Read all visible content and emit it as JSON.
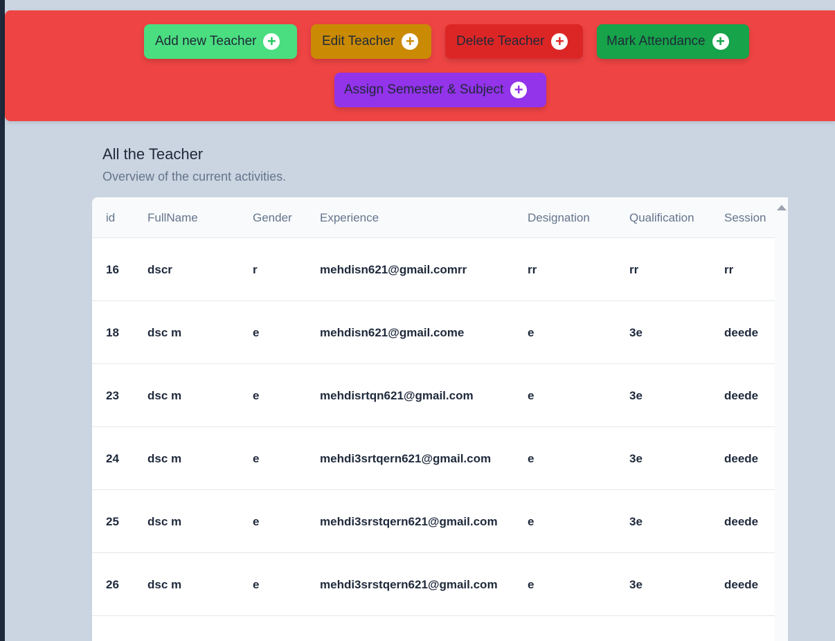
{
  "toolbar": {
    "buttons": [
      {
        "label": "Add new Teacher",
        "icon": "plus-circle-icon",
        "color": "#4ade80",
        "icon_color": "#22c55e"
      },
      {
        "label": "Edit Teacher",
        "icon": "plus-circle-icon",
        "color": "#ca8a04",
        "icon_color": "#ca8a04"
      },
      {
        "label": "Delete Teacher",
        "icon": "plus-circle-icon",
        "color": "#dc2626",
        "icon_color": "#dc2626"
      },
      {
        "label": "Mark Attendance",
        "icon": "plus-circle-icon",
        "color": "#16a34a",
        "icon_color": "#16a34a"
      },
      {
        "label": "Assign Semester & Subject",
        "icon": "plus-circle-icon",
        "color": "#9333ea",
        "icon_color": "#9333ea"
      }
    ],
    "background": "#ef4444"
  },
  "section": {
    "title": "All the Teacher",
    "subtitle": "Overview of the current activities."
  },
  "table": {
    "columns": [
      "id",
      "FullName",
      "Gender",
      "Experience",
      "Designation",
      "Qualification",
      "Session"
    ],
    "rows": [
      [
        "16",
        "dscr",
        "r",
        "mehdisn621@gmail.comrr",
        "rr",
        "rr",
        "rr"
      ],
      [
        "18",
        "dsc m",
        "e",
        "mehdisn621@gmail.come",
        "e",
        "3e",
        "deede"
      ],
      [
        "23",
        "dsc m",
        "e",
        "mehdisrtqn621@gmail.com",
        "e",
        "3e",
        "deede"
      ],
      [
        "24",
        "dsc m",
        "e",
        "mehdi3srtqern621@gmail.com",
        "e",
        "3e",
        "deede"
      ],
      [
        "25",
        "dsc m",
        "e",
        "mehdi3srstqern621@gmail.com",
        "e",
        "3e",
        "deede"
      ],
      [
        "26",
        "dsc m",
        "e",
        "mehdi3srstqern621@gmail.com",
        "e",
        "3e",
        "deede"
      ]
    ]
  }
}
